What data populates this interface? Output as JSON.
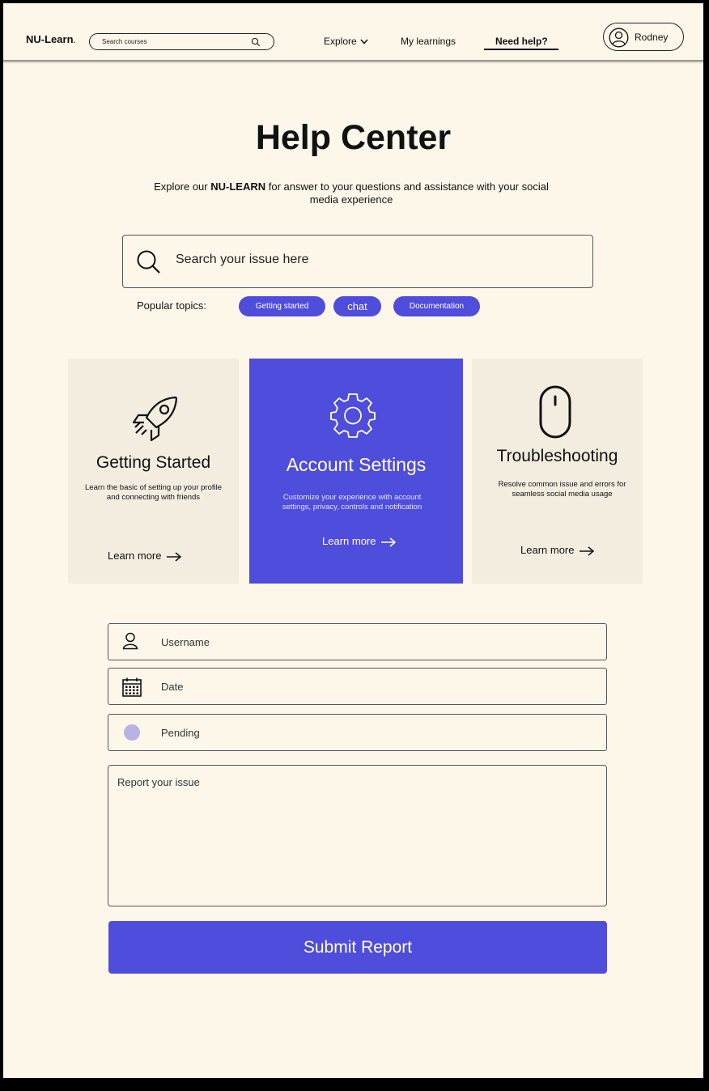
{
  "header": {
    "logo": "NU-Learn",
    "logo_dot": ".",
    "search_placeholder": "Search courses",
    "nav": {
      "explore": "Explore",
      "my_learnings": "My learnings",
      "need_help": "Need help?"
    },
    "user_name": "Rodney"
  },
  "hero": {
    "title": "Help Center",
    "subtitle_prefix": "Explore our ",
    "subtitle_brand": "NU-LEARN",
    "subtitle_suffix": " for answer to your questions and assistance with your social media experience",
    "search_placeholder": "Search your issue here",
    "popular_label": "Popular topics:",
    "topics": [
      "Getting started",
      "chat",
      "Documentation"
    ]
  },
  "cards": [
    {
      "icon": "rocket-icon",
      "title": "Getting Started",
      "description": "Learn the basic of setting up your profile and connecting with friends",
      "link": "Learn more"
    },
    {
      "icon": "gear-icon",
      "title": "Account Settings",
      "description": "Customize your experience with account settings, privacy, controls and notification",
      "link": "Learn more"
    },
    {
      "icon": "mouse-icon",
      "title": "Troubleshooting",
      "description": "Resolve common issue and errors for seamless social media usage",
      "link": "Learn more"
    }
  ],
  "form": {
    "username_placeholder": "Username",
    "date_placeholder": "Date",
    "status_placeholder": "Pending",
    "issue_placeholder": "Report your issue",
    "submit_label": "Submit Report"
  },
  "colors": {
    "accent": "#4f4ddb",
    "background": "#fdf7ea",
    "card": "#f3ede0",
    "status_dot": "#b8b2e8"
  }
}
